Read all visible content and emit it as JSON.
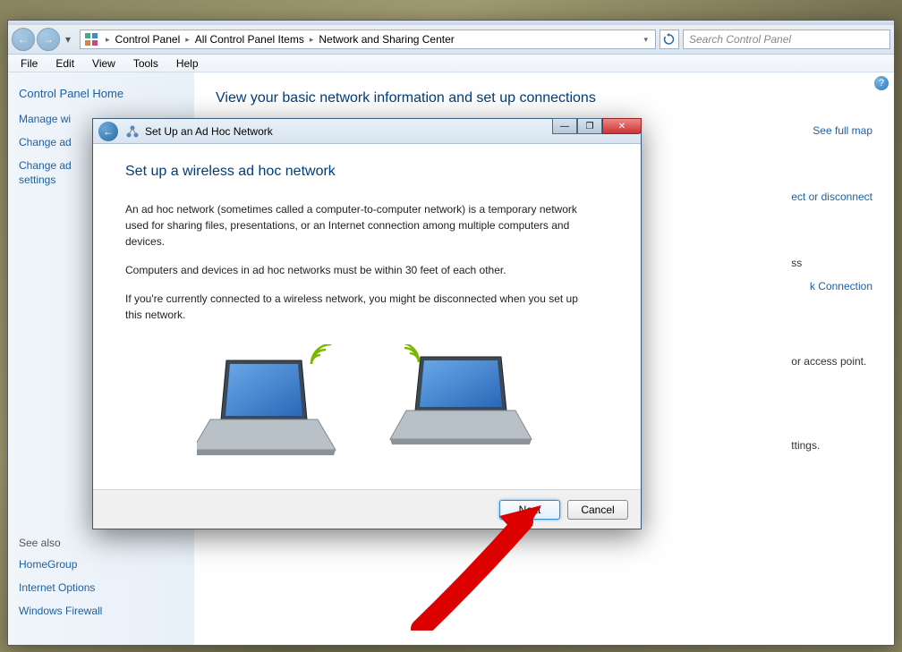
{
  "window_controls": {
    "min": "—",
    "max": "❐",
    "close": "✕"
  },
  "breadcrumb": {
    "seg1": "Control Panel",
    "seg2": "All Control Panel Items",
    "seg3": "Network and Sharing Center"
  },
  "search": {
    "placeholder": "Search Control Panel"
  },
  "menu": {
    "file": "File",
    "edit": "Edit",
    "view": "View",
    "tools": "Tools",
    "help": "Help"
  },
  "sidebar": {
    "home": "Control Panel Home",
    "items": [
      "Manage wi",
      "Change ad",
      "Change ad",
      "settings"
    ],
    "see_also": "See also",
    "subs": [
      "HomeGroup",
      "Internet Options",
      "Windows Firewall"
    ]
  },
  "main": {
    "title": "View your basic network information and set up connections",
    "full_map": "See full map",
    "connect": "ect or disconnect",
    "access": "ss",
    "kconn": "k Connection",
    "access_point": "or access point.",
    "settings": "ttings."
  },
  "wizard": {
    "title": "Set Up an Ad Hoc Network",
    "heading": "Set up a wireless ad hoc network",
    "p1": "An ad hoc network (sometimes called a computer-to-computer network) is a temporary network used for sharing files, presentations, or an Internet connection among multiple computers and devices.",
    "p2": "Computers and devices in ad hoc networks must be within 30 feet of each other.",
    "p3": "If you're currently connected to a wireless network, you might be disconnected when you set up this network.",
    "next": "Next",
    "cancel": "Cancel"
  }
}
